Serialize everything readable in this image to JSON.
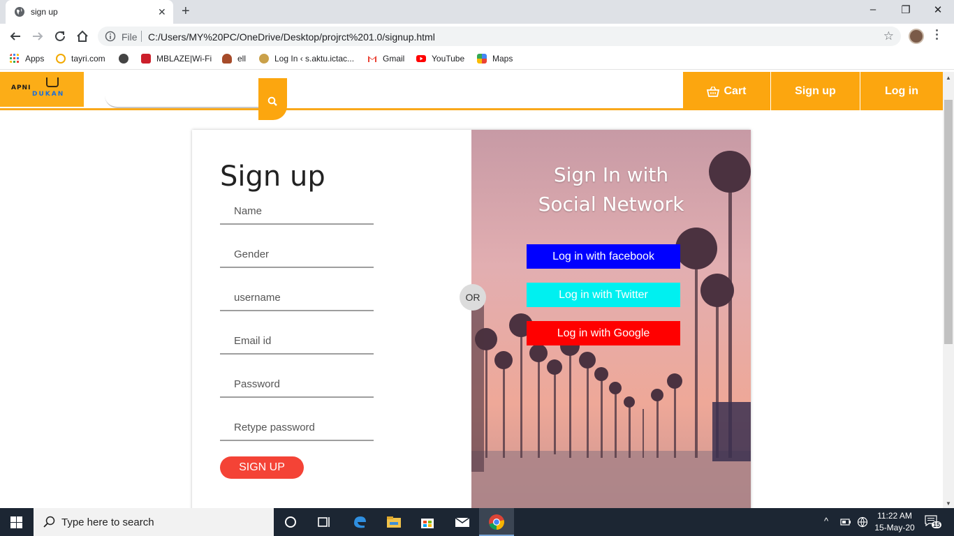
{
  "browser": {
    "tab_title": "sign up",
    "file_label": "File",
    "url": "C:/Users/MY%20PC/OneDrive/Desktop/projrct%201.0/signup.html",
    "bookmarks": [
      {
        "label": "Apps",
        "icon": "apps-grid-icon",
        "color": "#ea4335"
      },
      {
        "label": "tayri.com",
        "icon": "tayri-icon",
        "color": "#f2a900"
      },
      {
        "label": "",
        "icon": "globe-icon",
        "color": "#444444"
      },
      {
        "label": "MBLAZE|Wi-Fi",
        "icon": "mblaze-icon",
        "color": "#cc1f2b"
      },
      {
        "label": "ell",
        "icon": "ell-icon",
        "color": "#a64b2a"
      },
      {
        "label": "Log In ‹ s.aktu.ictac...",
        "icon": "aktu-icon",
        "color": "#caa14a"
      },
      {
        "label": "Gmail",
        "icon": "gmail-icon",
        "color": "#ea4335"
      },
      {
        "label": "YouTube",
        "icon": "youtube-icon",
        "color": "#ff0000"
      },
      {
        "label": "Maps",
        "icon": "maps-icon",
        "color": "#34a853"
      }
    ]
  },
  "site": {
    "logo_line1": "APNI",
    "logo_line2": "DUKAN",
    "search_placeholder": "",
    "nav": {
      "cart": "Cart",
      "signup": "Sign up",
      "login": "Log in"
    },
    "accent_color": "#fca60f"
  },
  "form": {
    "title": "Sign up",
    "fields": [
      {
        "placeholder": "Name"
      },
      {
        "placeholder": "Gender"
      },
      {
        "placeholder": "username"
      },
      {
        "placeholder": "Email id"
      },
      {
        "placeholder": "Password"
      },
      {
        "placeholder": "Retype password"
      }
    ],
    "submit_label": "SIGN UP",
    "or_label": "OR"
  },
  "social": {
    "title_line1": "Sign In with",
    "title_line2": "Social Network",
    "facebook": "Log in with facebook",
    "twitter": "Log in with Twitter",
    "google": "Log in with Google"
  },
  "taskbar": {
    "search_placeholder": "Type here to search",
    "time": "11:22 AM",
    "date": "15-May-20",
    "notifications": "15"
  }
}
